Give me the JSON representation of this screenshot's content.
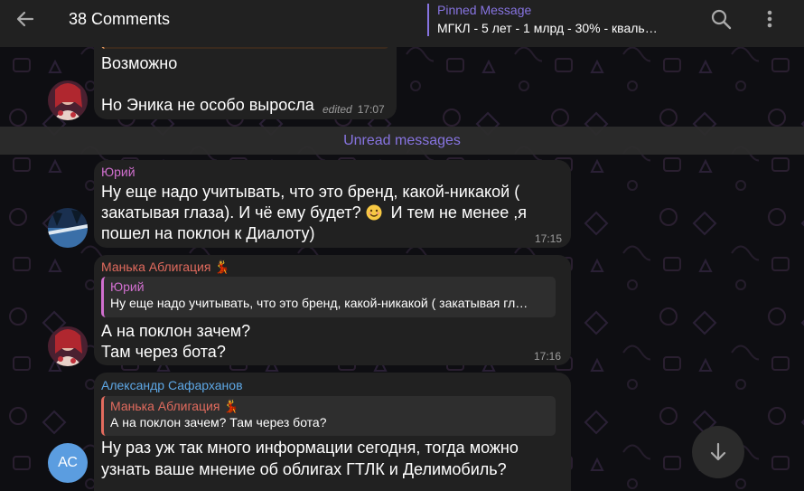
{
  "header": {
    "title": "38 Comments",
    "pinned_label": "Pinned Message",
    "pinned_text": "МГКЛ - 5 лет - 1 млрд - 30% - кваль…"
  },
  "messages": [
    {
      "text_lines": [
        "Возможно",
        "",
        "Но Эника не особо выросла"
      ],
      "edited_label": "edited",
      "time": "17:07"
    },
    {
      "sender": "Юрий",
      "sender_color": "#d06fce",
      "text_lines": [
        "Ну еще надо учитывать, что это бренд, какой-никакой (",
        "закатывая глаза). И чё ему будет?",
        "  И тем не менее ,я",
        "пошел на поклон к Диалоту)"
      ],
      "time": "17:15"
    },
    {
      "sender": "Манька Аблигация",
      "sender_color": "#e26b5e",
      "reply_sender": "Юрий",
      "reply_color": "#d06fce",
      "reply_text": "Ну еще надо учитывать, что это бренд, какой-никакой ( закатывая гл…",
      "text_lines": [
        "А на поклон зачем?",
        "Там через бота?"
      ],
      "time": "17:16"
    },
    {
      "sender": "Александр Сафарханов",
      "sender_color": "#5ea8e6",
      "avatar_initials": "АС",
      "reply_sender": "Манька Аблигация",
      "reply_color": "#e26b5e",
      "reply_text": "А на поклон зачем? Там через бота?",
      "text_lines": [
        "Ну раз уж так много информации сегодня, тогда можно",
        "узнать ваше мнение об облигах ГТЛК и Делимобиль?"
      ]
    }
  ],
  "unread_label": "Unread messages",
  "icons": {
    "back": "arrow-left-icon",
    "search": "search-icon",
    "more": "more-vertical-icon",
    "scroll_down": "arrow-down-icon"
  },
  "colors": {
    "accent": "#8774e1",
    "bubble": "#212121",
    "header": "#212121"
  }
}
